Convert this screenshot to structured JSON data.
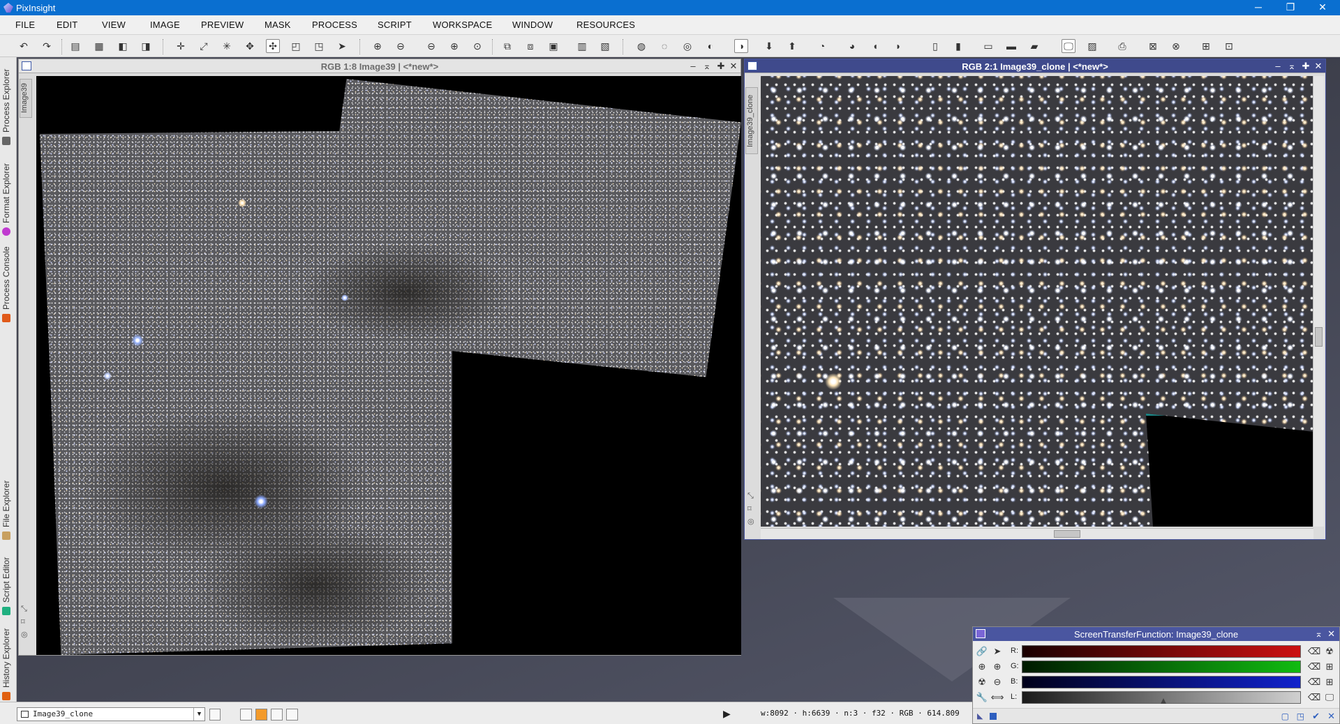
{
  "app": {
    "title": "PixInsight"
  },
  "window_controls": {
    "minimize": "─",
    "restore": "❐",
    "close": "✕"
  },
  "menu": [
    "FILE",
    "EDIT",
    "VIEW",
    "IMAGE",
    "PREVIEW",
    "MASK",
    "PROCESS",
    "SCRIPT",
    "WORKSPACE",
    "WINDOW",
    "RESOURCES"
  ],
  "left_dock": {
    "tabs": [
      "Process Explorer",
      "Format Explorer",
      "Process Console",
      "File Explorer",
      "Script Editor",
      "History Explorer"
    ]
  },
  "image_windows": [
    {
      "title": "RGB 1:8 Image39 | <*new*>",
      "side_label": "Image39",
      "focused": false
    },
    {
      "title": "RGB 2:1 Image39_clone | <*new*>",
      "side_label": "Image39_clone",
      "focused": true
    }
  ],
  "stf": {
    "title": "ScreenTransferFunction: Image39_clone",
    "channels": [
      {
        "label": "R:",
        "color": "#cc1111"
      },
      {
        "label": "G:",
        "color": "#11bb11"
      },
      {
        "label": "B:",
        "color": "#1122cc"
      },
      {
        "label": "L:",
        "color": "#d0d0d0"
      }
    ]
  },
  "statusbar": {
    "view_selector": "Image39_clone",
    "info": "w:8092 · h:6639 · n:3 · f32 · RGB · 614.809"
  }
}
